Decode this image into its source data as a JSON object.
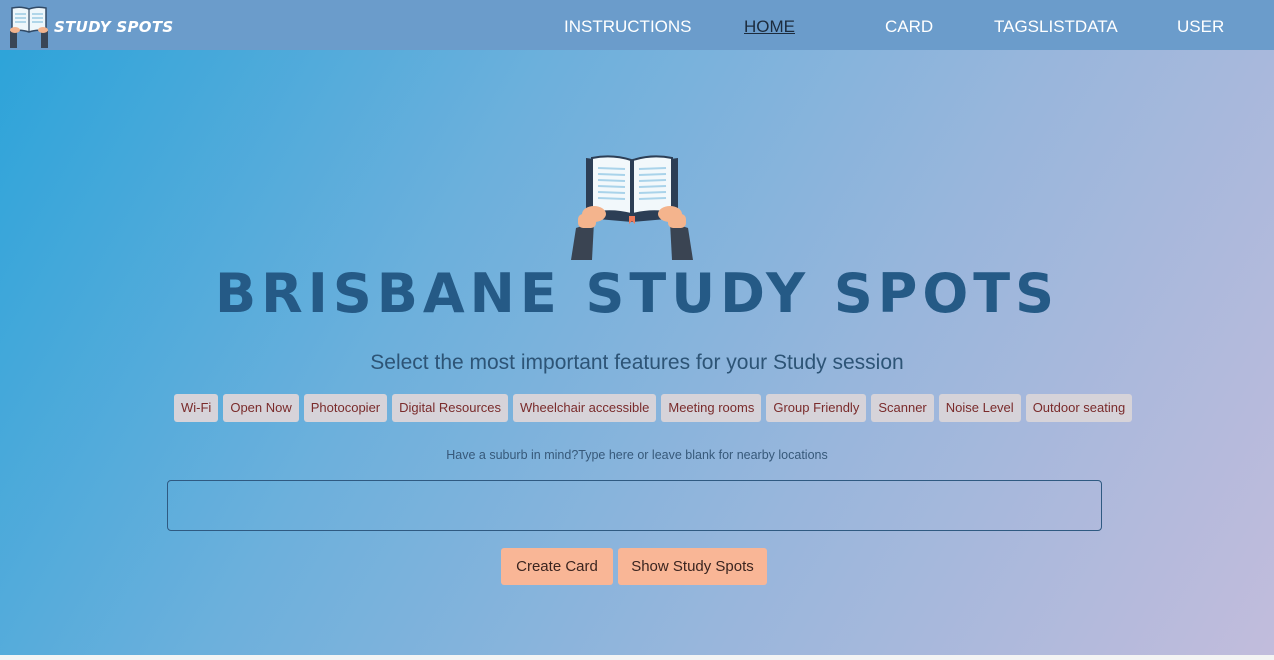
{
  "brand": {
    "name": "STUDY SPOTS"
  },
  "nav": {
    "items": [
      {
        "label": "INSTRUCTIONS",
        "active": false
      },
      {
        "label": "HOME",
        "active": true
      },
      {
        "label": "CARD",
        "active": false
      },
      {
        "label": "TAGSLISTDATA",
        "active": false
      },
      {
        "label": "USER",
        "active": false
      }
    ]
  },
  "hero": {
    "icon": "open-book-hands-icon",
    "title": "BRISBANE STUDY SPOTS",
    "subtitle": "Select the most important features for your Study session"
  },
  "tags": [
    "Wi-Fi",
    "Open Now",
    "Photocopier",
    "Digital Resources",
    "Wheelchair accessible",
    "Meeting rooms",
    "Group Friendly",
    "Scanner",
    "Noise Level",
    "Outdoor seating"
  ],
  "search": {
    "hint": "Have a suburb in mind?Type here or leave blank for nearby locations",
    "value": ""
  },
  "actions": {
    "create_label": "Create Card",
    "show_label": "Show Study Spots"
  },
  "colors": {
    "nav_bg": "#6b9ccb",
    "title": "#255a86",
    "tag_bg": "#d6d3d9",
    "tag_text": "#7a2b2b",
    "button_bg": "#f9b696"
  }
}
